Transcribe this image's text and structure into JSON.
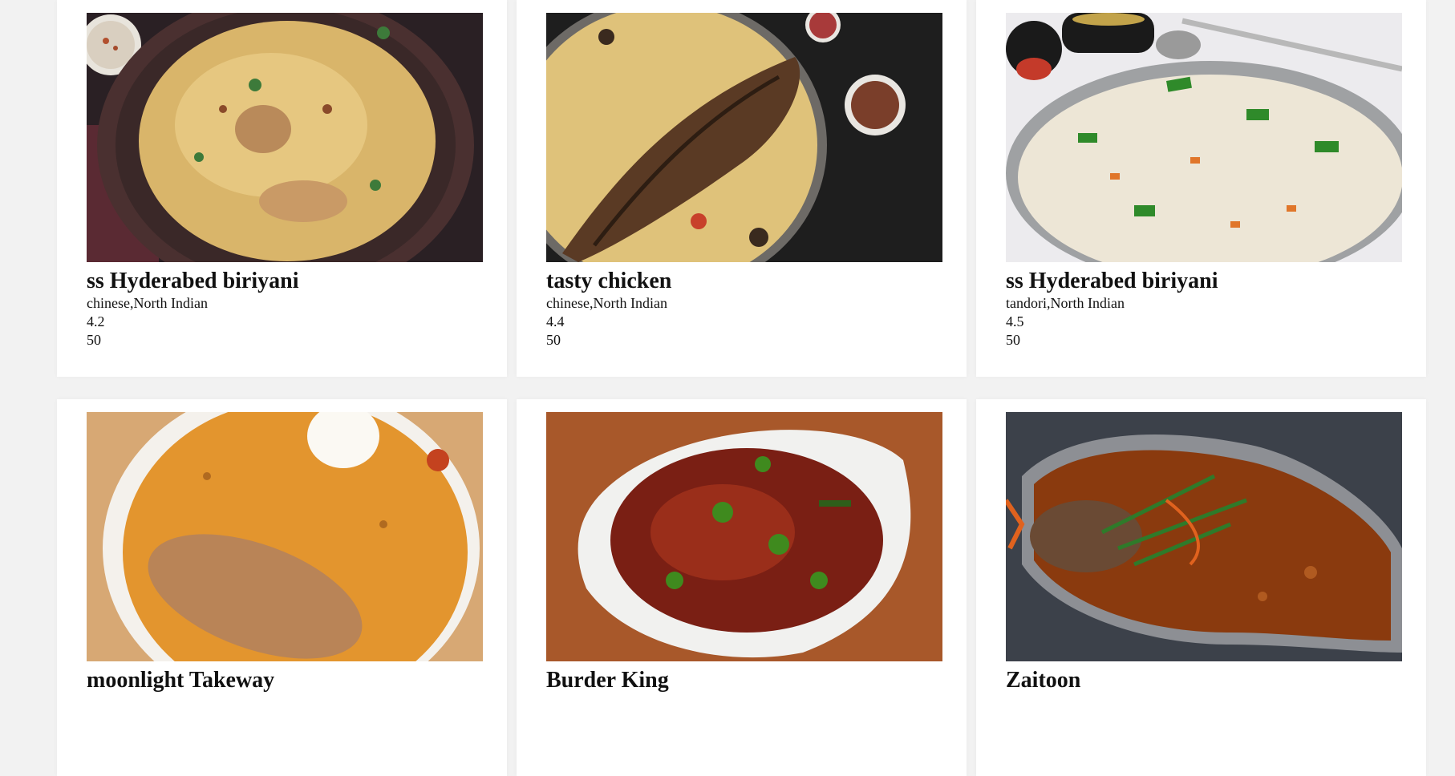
{
  "restaurants": [
    {
      "name": "ss Hyderabed biriyani",
      "cuisines": "chinese,North Indian",
      "rating": "4.2",
      "price": "50",
      "image": "biryani-plate-photo"
    },
    {
      "name": "tasty chicken",
      "cuisines": "chinese,North Indian",
      "rating": "4.4",
      "price": "50",
      "image": "fish-rice-platter-photo"
    },
    {
      "name": "ss Hyderabed biriyani",
      "cuisines": "tandori,North Indian",
      "rating": "4.5",
      "price": "50",
      "image": "fried-rice-photo"
    },
    {
      "name": "moonlight Takeway",
      "cuisines": "",
      "rating": "",
      "price": "",
      "image": "chicken-biryani-bowl-photo"
    },
    {
      "name": "Burder King",
      "cuisines": "",
      "rating": "",
      "price": "",
      "image": "chilli-chicken-plate-photo"
    },
    {
      "name": "Zaitoon",
      "cuisines": "",
      "rating": "",
      "price": "",
      "image": "fish-curry-dish-photo"
    }
  ]
}
